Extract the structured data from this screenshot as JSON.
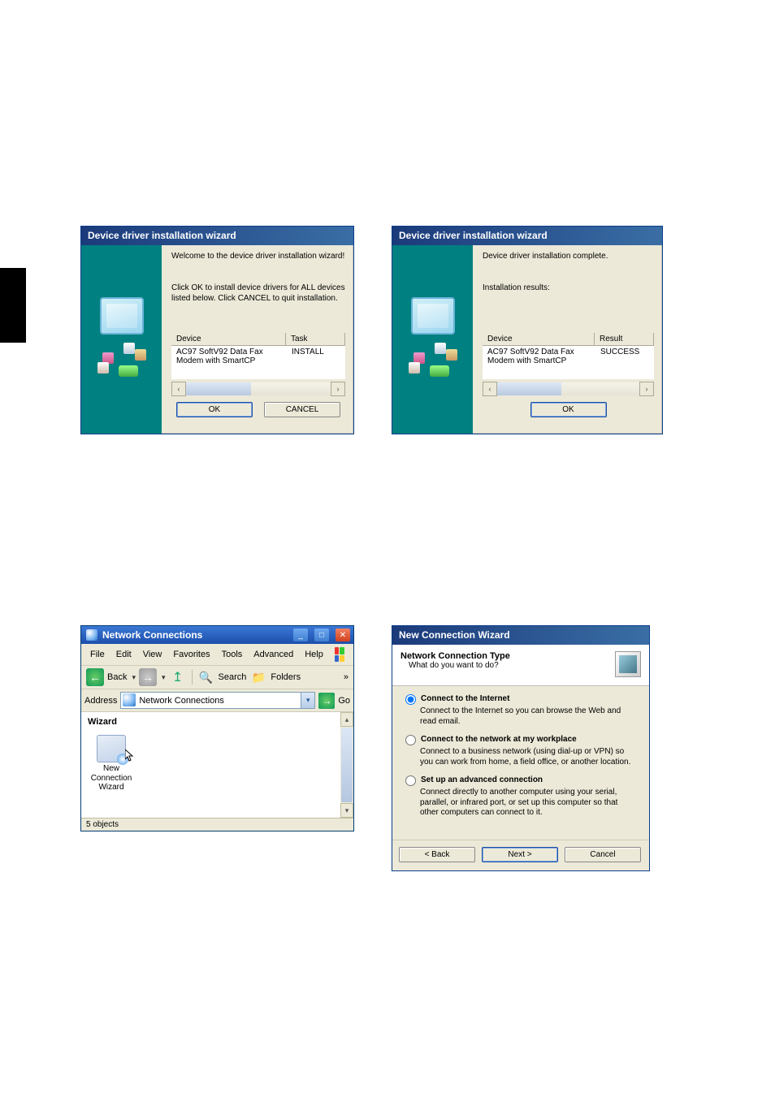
{
  "wizard1": {
    "title": "Device driver installation wizard",
    "intro": "Welcome to the device driver installation wizard!",
    "sub": "Click OK to install device drivers for ALL devices listed below. Click CANCEL to quit installation.",
    "colDevice": "Device",
    "colTask": "Task",
    "rowDevice": "AC97 SoftV92 Data Fax Modem with SmartCP",
    "rowTask": "INSTALL",
    "ok": "OK",
    "cancel": "CANCEL"
  },
  "wizard2": {
    "title": "Device driver installation wizard",
    "intro": "Device driver installation complete.",
    "sub": "Installation results:",
    "colDevice": "Device",
    "colResult": "Result",
    "rowDevice": "AC97 SoftV92 Data Fax Modem with SmartCP",
    "rowResult": "SUCCESS",
    "ok": "OK"
  },
  "explorer": {
    "title": "Network Connections",
    "menu": {
      "file": "File",
      "edit": "Edit",
      "view": "View",
      "favorites": "Favorites",
      "tools": "Tools",
      "advanced": "Advanced",
      "help": "Help"
    },
    "toolbar": {
      "back": "Back",
      "search": "Search",
      "folders": "Folders"
    },
    "address_label": "Address",
    "address_value": "Network Connections",
    "go": "Go",
    "section": "Wizard",
    "item": "New Connection Wizard",
    "status": "5 objects"
  },
  "ncw": {
    "title": "New Connection Wizard",
    "heading": "Network Connection Type",
    "subheading": "What do you want to do?",
    "opt1": "Connect to the Internet",
    "opt1d": "Connect to the Internet so you can browse the Web and read email.",
    "opt2": "Connect to the network at my workplace",
    "opt2d": "Connect to a business network (using dial-up or VPN) so you can work from home, a field office, or another location.",
    "opt3": "Set up an advanced connection",
    "opt3d": "Connect directly to another computer using your serial, parallel, or infrared port, or set up this computer so that other computers can connect to it.",
    "back": "< Back",
    "next": "Next >",
    "cancel": "Cancel"
  }
}
